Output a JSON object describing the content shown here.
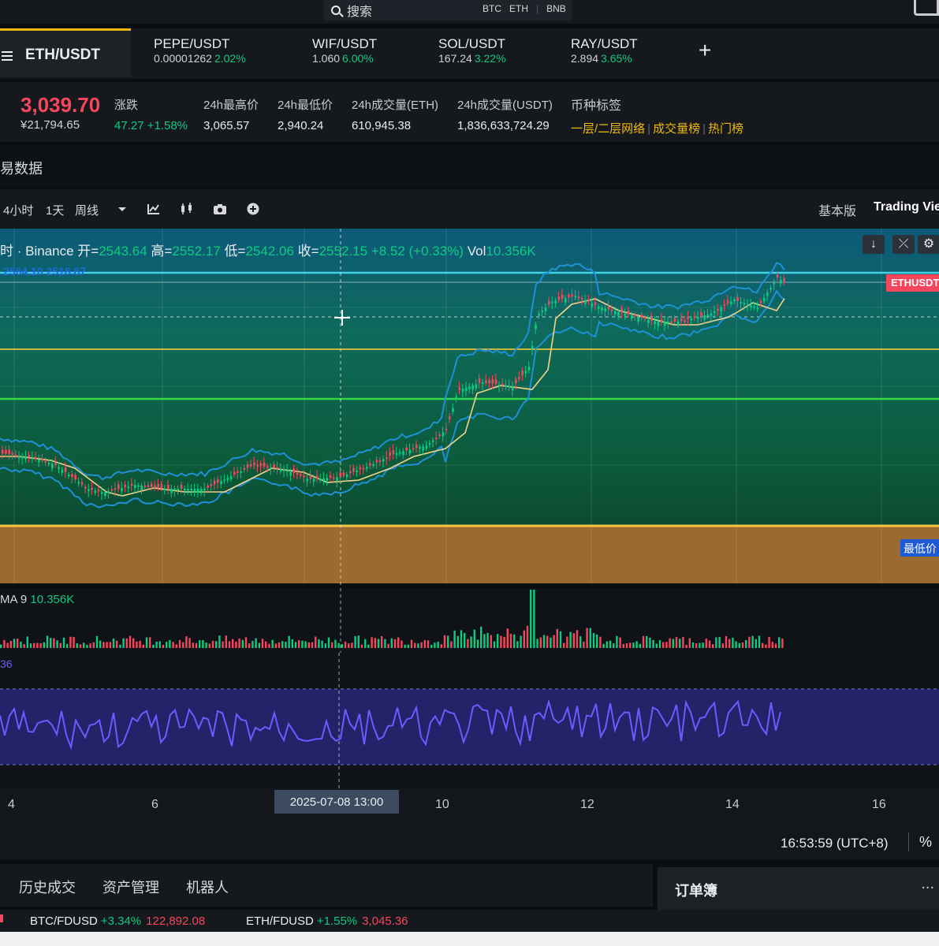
{
  "search": {
    "placeholder": "搜索",
    "quick": [
      "BTC",
      "ETH",
      "BNB"
    ]
  },
  "pair_tabs": {
    "active": "ETH/USDT",
    "items": [
      {
        "name": "PEPE/USDT",
        "price": "0.00001262",
        "change": "2.02%"
      },
      {
        "name": "WIF/USDT",
        "price": "1.060",
        "change": "6.00%"
      },
      {
        "name": "SOL/USDT",
        "price": "167.24",
        "change": "3.22%"
      },
      {
        "name": "RAY/USDT",
        "price": "2.894",
        "change": "3.65%"
      }
    ],
    "add": "+"
  },
  "ticker": {
    "price": "3,039.70",
    "price_cny": "¥21,794.65",
    "change_label": "涨跌",
    "change_value": "47.27 +1.58%",
    "high_label": "24h最高价",
    "high_value": "3,065.57",
    "low_label": "24h最低价",
    "low_value": "2,940.24",
    "vol_eth_label": "24h成交量(ETH)",
    "vol_eth_value": "610,945.38",
    "vol_usdt_label": "24h成交量(USDT)",
    "vol_usdt_value": "1,836,633,724.29",
    "tags_label": "币种标签",
    "tags": [
      "一层/二层网络",
      "成交量榜",
      "热门榜"
    ]
  },
  "section_title": "易数据",
  "toolbar": {
    "intervals": [
      "4小时",
      "1天",
      "周线"
    ],
    "view_basic": "基本版",
    "view_tradingview": "Trading Vie"
  },
  "legend": {
    "prefix": "时 · Binance",
    "open_label": "开=",
    "open": "2543.64",
    "high_label": "高=",
    "high": "2552.17",
    "low_label": "低=",
    "low": "2542.06",
    "close_label": "收=",
    "close": "2552.15",
    "change": "+8.52 (+0.33%)",
    "vol_label": "Vol",
    "vol": "10.356K",
    "bb": "2564.10  2518.87"
  },
  "price_tags": {
    "current": "ETHUSDT",
    "low": "最低价"
  },
  "volume": {
    "label": "MA 9",
    "value": "10.356K"
  },
  "rsi": {
    "label": "36"
  },
  "axis": {
    "ticks": [
      "4",
      "6",
      "10",
      "12",
      "14",
      "16"
    ],
    "crosshair": "2025-07-08    13:00"
  },
  "clock": {
    "time": "16:53:59 (UTC+8)",
    "percent": "%"
  },
  "bottom_tabs": [
    "历史成交",
    "资产管理",
    "机器人"
  ],
  "orderbook": {
    "title": "订单簿",
    "more": "..."
  },
  "bottom_ticker": [
    {
      "name": "BTC/FDUSD",
      "change": "+3.34%",
      "price": "122,892.08"
    },
    {
      "name": "ETH/FDUSD",
      "change": "+1.55%",
      "price": "3,045.36"
    }
  ],
  "colors": {
    "up": "#0ecb81",
    "down": "#f6465d",
    "accent": "#f0b90b",
    "bb": "#1e90d6",
    "rsi": "#6a5cff"
  }
}
